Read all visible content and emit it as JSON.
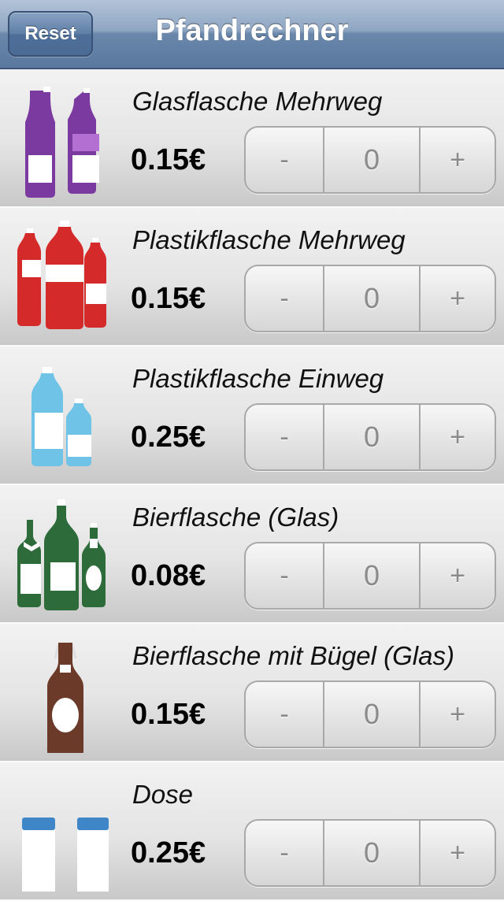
{
  "navbar": {
    "title": "Pfandrechner",
    "reset_label": "Reset"
  },
  "items": [
    {
      "name": "Glasflasche Mehrweg",
      "price": "0.15€",
      "count": "0",
      "minus": "-",
      "plus": "+",
      "icon": "glass-bottles-icon",
      "color": "#7b3aa0"
    },
    {
      "name": "Plastikflasche Mehrweg",
      "price": "0.15€",
      "count": "0",
      "minus": "-",
      "plus": "+",
      "icon": "plastic-bottles-returnable-icon",
      "color": "#d52a2a"
    },
    {
      "name": "Plastikflasche Einweg",
      "price": "0.25€",
      "count": "0",
      "minus": "-",
      "plus": "+",
      "icon": "plastic-bottles-disposable-icon",
      "color": "#6ec3e6"
    },
    {
      "name": "Bierflasche (Glas)",
      "price": "0.08€",
      "count": "0",
      "minus": "-",
      "plus": "+",
      "icon": "beer-bottles-icon",
      "color": "#2e6b3a"
    },
    {
      "name": "Bierflasche mit Bügel (Glas)",
      "price": "0.15€",
      "count": "0",
      "minus": "-",
      "plus": "+",
      "icon": "swing-top-bottle-icon",
      "color": "#6b3a28"
    },
    {
      "name": "Dose",
      "price": "0.25€",
      "count": "0",
      "minus": "-",
      "plus": "+",
      "icon": "can-icon",
      "color": "#3f86c9"
    }
  ]
}
